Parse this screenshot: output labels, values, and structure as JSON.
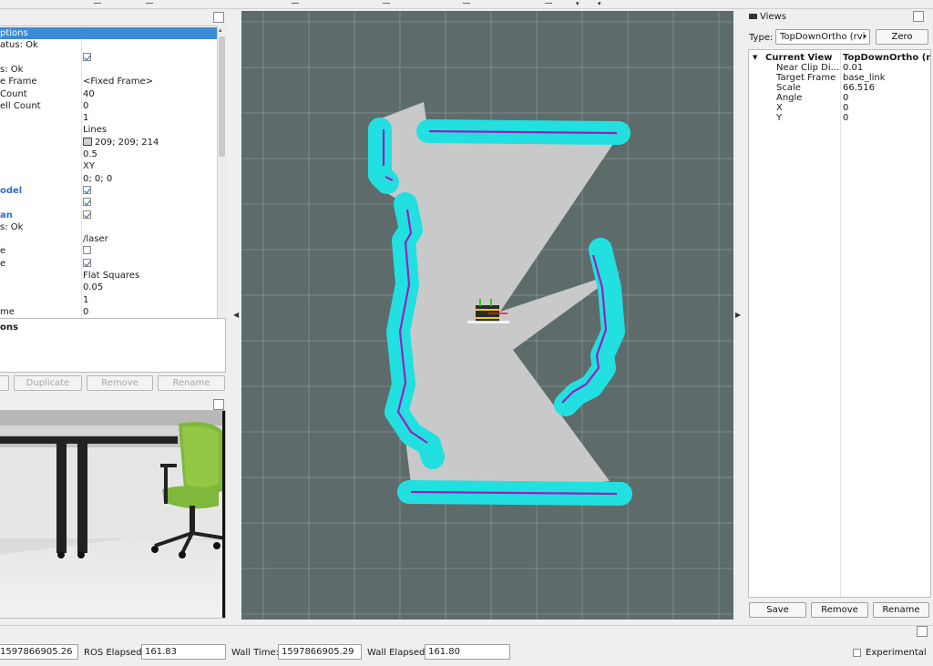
{
  "displays": {
    "rows": [
      {
        "key": "ptions",
        "value": "",
        "selected": true
      },
      {
        "key": "atus: Ok",
        "value": ""
      },
      {
        "key": "",
        "value": "",
        "check": true
      },
      {
        "key": "s: Ok",
        "value": ""
      },
      {
        "key": "e Frame",
        "value": "<Fixed Frame>"
      },
      {
        "key": " Count",
        "value": "40"
      },
      {
        "key": "ell Count",
        "value": "0"
      },
      {
        "key": "",
        "value": "1"
      },
      {
        "key": "",
        "value": "Lines"
      },
      {
        "key": "",
        "value": "209; 209; 214",
        "swatch": true
      },
      {
        "key": "",
        "value": "0.5"
      },
      {
        "key": "",
        "value": "XY"
      },
      {
        "key": "",
        "value": "0; 0; 0"
      },
      {
        "key": "odel",
        "value": "",
        "check": true,
        "blue": true
      },
      {
        "key": "",
        "value": "",
        "check": true
      },
      {
        "key": "an",
        "value": "",
        "check": true,
        "blue": true
      },
      {
        "key": "s: Ok",
        "value": ""
      },
      {
        "key": "",
        "value": "/laser"
      },
      {
        "key": "e",
        "value": "",
        "check": false
      },
      {
        "key": "e",
        "value": "",
        "check": true
      },
      {
        "key": "",
        "value": "Flat Squares"
      },
      {
        "key": "",
        "value": "0.05"
      },
      {
        "key": "",
        "value": "1"
      },
      {
        "key": "me",
        "value": "0"
      }
    ],
    "description_title": "ons",
    "buttons": {
      "duplicate": "Duplicate",
      "remove": "Remove",
      "rename": "Rename"
    }
  },
  "views": {
    "title": "Views",
    "type_label": "Type:",
    "type_value": "TopDownOrtho (rvi",
    "zero_label": "Zero",
    "current_view_label": "Current View",
    "current_view_value": "TopDownOrtho (r...",
    "properties": [
      {
        "key": "Near Clip Di...",
        "value": "0.01"
      },
      {
        "key": "Target Frame",
        "value": "base_link"
      },
      {
        "key": "Scale",
        "value": "66.516"
      },
      {
        "key": "Angle",
        "value": "0"
      },
      {
        "key": "X",
        "value": "0"
      },
      {
        "key": "Y",
        "value": "0"
      }
    ],
    "buttons": {
      "save": "Save",
      "remove": "Remove",
      "rename": "Rename"
    }
  },
  "time": {
    "ros_time_value": "1597866905.26",
    "ros_elapsed_label": "ROS Elapsed:",
    "ros_elapsed_value": "161.83",
    "wall_time_label": "Wall Time:",
    "wall_time_value": "1597866905.29",
    "wall_elapsed_label": "Wall Elapsed:",
    "wall_elapsed_value": "161.80",
    "experimental_label": "Experimental"
  },
  "colors": {
    "background": "#5e6b6b",
    "grid": "#a9b4b4",
    "laser_fill": "#c9c9c9",
    "inflation": "#22e0e0",
    "obstacle": "#9b1fbf",
    "selection": "#3a8bd6"
  }
}
